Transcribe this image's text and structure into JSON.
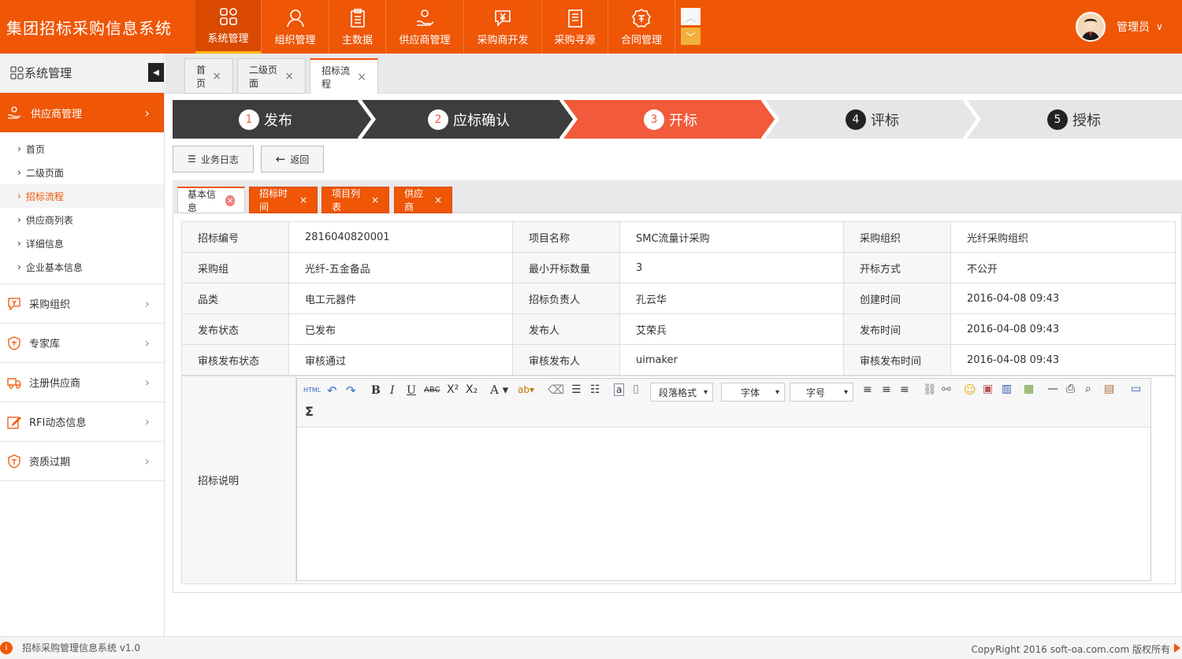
{
  "app": {
    "title": "集团招标采购信息系统"
  },
  "nav": {
    "items": [
      {
        "label": "系统管理",
        "icon": "grid-icon"
      },
      {
        "label": "组织管理",
        "icon": "user-icon"
      },
      {
        "label": "主数据",
        "icon": "clipboard-icon"
      },
      {
        "label": "供应商管理",
        "icon": "handshake-icon"
      },
      {
        "label": "采购商开发",
        "icon": "yen-chat-icon"
      },
      {
        "label": "采购寻源",
        "icon": "document-icon"
      },
      {
        "label": "合同管理",
        "icon": "badge-icon"
      }
    ]
  },
  "user": {
    "name": "管理员"
  },
  "sidebar": {
    "title": "系统管理",
    "active_menu": "供应商管理",
    "subitems": [
      "首页",
      "二级页面",
      "招标流程",
      "供应商列表",
      "详细信息",
      "企业基本信息"
    ],
    "menus": [
      "采购组织",
      "专家库",
      "注册供应商",
      "RFI动态信息",
      "资质过期"
    ]
  },
  "tabs": [
    "首页",
    "二级页面",
    "招标流程"
  ],
  "steps": [
    {
      "num": "1",
      "label": "发布"
    },
    {
      "num": "2",
      "label": "应标确认"
    },
    {
      "num": "3",
      "label": "开标"
    },
    {
      "num": "4",
      "label": "评标"
    },
    {
      "num": "5",
      "label": "授标"
    }
  ],
  "buttons": {
    "log": "业务日志",
    "back": "返回"
  },
  "subtabs": [
    "基本信息",
    "招标时间",
    "项目列表",
    "供应商"
  ],
  "info": {
    "rows": [
      [
        "招标编号",
        "2816040820001",
        "项目名称",
        "SMC流量计采购",
        "采购组织",
        "光纤采购组织"
      ],
      [
        "采购组",
        "光纤-五金备品",
        "最小开标数量",
        "3",
        "开标方式",
        "不公开"
      ],
      [
        "品类",
        "电工元器件",
        "招标负责人",
        "孔云华",
        "创建时间",
        "2016-04-08 09:43"
      ],
      [
        "发布状态",
        "已发布",
        "发布人",
        "艾荣兵",
        "发布时间",
        "2016-04-08 09:43"
      ],
      [
        "审核发布状态",
        "审核通过",
        "审核发布人",
        "uimaker",
        "审核发布时间",
        "2016-04-08 09:43"
      ]
    ],
    "desc_label": "招标说明"
  },
  "editor": {
    "paragraph": "段落格式",
    "font": "字体",
    "size": "字号",
    "html": "HTML",
    "sigma": "Σ"
  },
  "footer": {
    "left": "招标采购管理信息系统 v1.0",
    "right": "CopyRight 2016  soft-oa.com.com 版权所有"
  },
  "colors": {
    "accent": "#ef5606",
    "dark": "#3d3d3d",
    "step_active": "#f15a3a",
    "step_idle": "#e6e6e6"
  }
}
